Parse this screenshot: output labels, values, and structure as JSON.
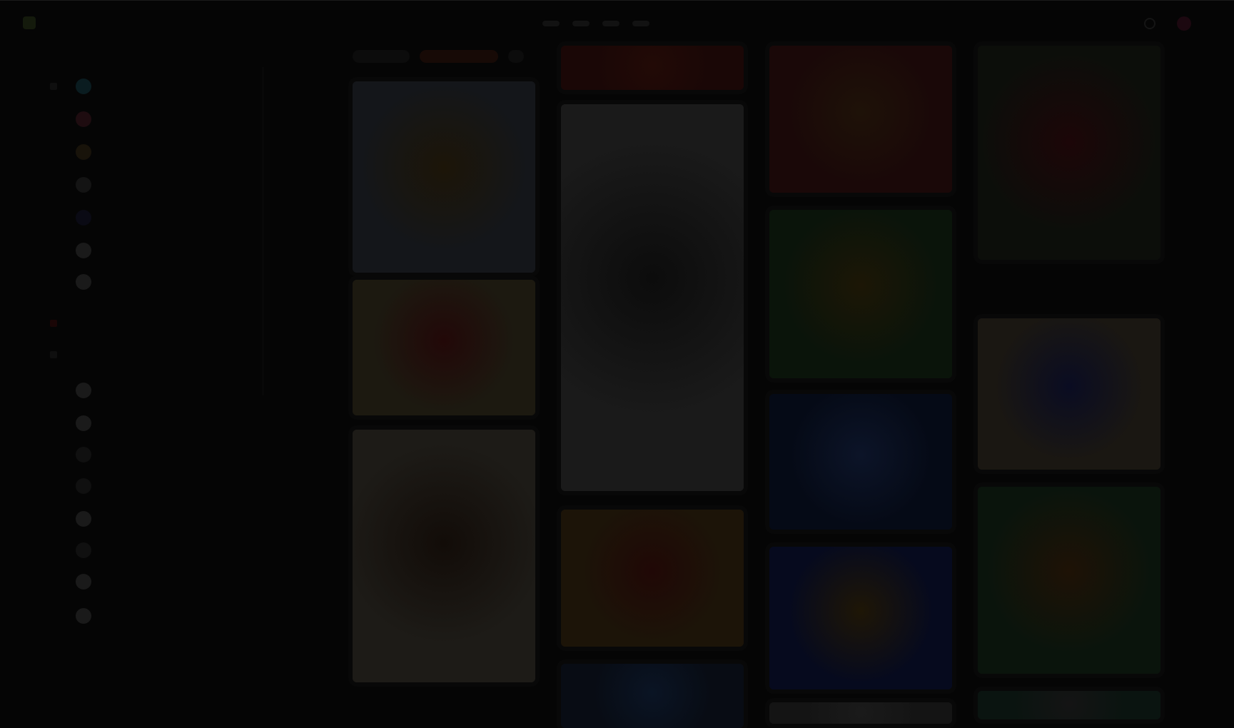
{
  "theme": {
    "background": "#050505",
    "overlay_note": "dimmed"
  },
  "header": {
    "logo_icon": "app-logo-icon",
    "nav_items": [
      "",
      "",
      "",
      ""
    ],
    "search_icon": "search-icon",
    "avatar_icon": "user-avatar-icon"
  },
  "sidebar": {
    "sections": [
      {
        "label": ""
      },
      {
        "label": ""
      },
      {
        "label": ""
      }
    ],
    "items": [
      {
        "label": "",
        "color": "#0a1c20"
      },
      {
        "label": "",
        "color": "#1e0c10"
      },
      {
        "label": "",
        "color": "#18130a"
      },
      {
        "label": "",
        "color": "#141414"
      },
      {
        "label": "",
        "color": "#0a0a14"
      },
      {
        "label": "",
        "color": "#1a1a1a"
      },
      {
        "label": "",
        "color": "#1a1a1a"
      },
      {
        "label": "",
        "color": "#1a1a1a"
      },
      {
        "label": "",
        "color": "#1a1a1a"
      },
      {
        "label": "",
        "color": "#101010"
      },
      {
        "label": "",
        "color": "#101010"
      },
      {
        "label": "",
        "color": "#1a1a1a"
      },
      {
        "label": "",
        "color": "#101010"
      },
      {
        "label": "",
        "color": "#1a1a1a"
      },
      {
        "label": "",
        "color": "#1a1a1a"
      }
    ]
  },
  "feed": {
    "filters": [
      "",
      "",
      ""
    ],
    "cards": [
      {
        "column": 0,
        "bg": "#14161a",
        "accent": "#1c1508"
      },
      {
        "column": 0,
        "bg": "#1c1910",
        "accent": "#220808"
      },
      {
        "column": 0,
        "bg": "#1d1b17",
        "accent": "#120c08"
      },
      {
        "column": 1,
        "bg": "#1a0706",
        "accent": "#220a06"
      },
      {
        "column": 1,
        "bg": "#1a1a1a",
        "accent": "#0c0c0c"
      },
      {
        "column": 1,
        "bg": "#1c1408",
        "accent": "#200806"
      },
      {
        "column": 1,
        "bg": "#080c14",
        "accent": "#0a1424"
      },
      {
        "column": 2,
        "bg": "#1a0808",
        "accent": "#1e1208"
      },
      {
        "column": 2,
        "bg": "#0a140a",
        "accent": "#1c1606"
      },
      {
        "column": 2,
        "bg": "#050a16",
        "accent": "#0c1428"
      },
      {
        "column": 2,
        "bg": "#060a1e",
        "accent": "#1e1606"
      },
      {
        "column": 2,
        "bg": "#141414",
        "accent": "#1a1a1a"
      },
      {
        "column": 3,
        "bg": "#0c0e0a",
        "accent": "#1c0608"
      },
      {
        "column": 3,
        "bg": "#1a1712",
        "accent": "#0a0c22"
      },
      {
        "column": 3,
        "bg": "#0a140c",
        "accent": "#1e1206"
      },
      {
        "column": 3,
        "bg": "#0a1410",
        "accent": "#141414"
      }
    ]
  }
}
